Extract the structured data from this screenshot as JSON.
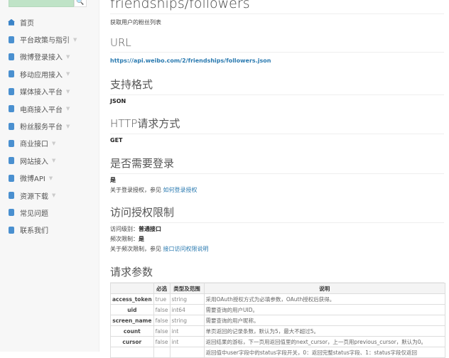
{
  "sidebar": {
    "items": [
      {
        "label": "首页",
        "chev": false
      },
      {
        "label": "平台政策与指引",
        "chev": true
      },
      {
        "label": "微博登录接入",
        "chev": true
      },
      {
        "label": "移动应用接入",
        "chev": true
      },
      {
        "label": "媒体接入平台",
        "chev": true
      },
      {
        "label": "电商接入平台",
        "chev": true
      },
      {
        "label": "粉丝服务平台",
        "chev": true
      },
      {
        "label": "商业接口",
        "chev": true
      },
      {
        "label": "网站接入",
        "chev": true
      },
      {
        "label": "微博API",
        "chev": true
      },
      {
        "label": "资源下载",
        "chev": true
      },
      {
        "label": "常见问题",
        "chev": false
      },
      {
        "label": "联系我们",
        "chev": false
      }
    ]
  },
  "main": {
    "title": "friendships/followers",
    "desc": "获取用户的粉丝列表",
    "url_heading": "URL",
    "url": "https://api.weibo.com/2/friendships/followers.json",
    "format_heading": "支持格式",
    "format": "JSON",
    "method_heading": "HTTP请求方式",
    "method": "GET",
    "login_heading": "是否需要登录",
    "login": "是",
    "login_note": "关于登录授权，参见 ",
    "login_link": "如何登录授权",
    "limit_heading": "访问授权限制",
    "level_label": "访问级别：",
    "level": "普通接口",
    "rate_label": "频次限制：",
    "rate": "是",
    "rate_note": "关于频次限制，参见 ",
    "rate_link": "接口访问权限说明",
    "params_heading": "请求参数",
    "table": {
      "headers": [
        "",
        "必选",
        "类型及范围",
        "说明"
      ],
      "rows": [
        [
          "access_token",
          "true",
          "string",
          "采用OAuth授权方式为必填参数，OAuth授权后获得。"
        ],
        [
          "uid",
          "false",
          "int64",
          "需要查询的用户UID。"
        ],
        [
          "screen_name",
          "false",
          "string",
          "需要查询的用户昵称。"
        ],
        [
          "count",
          "false",
          "int",
          "单页返回的记录条数，默认为5，最大不超过5。"
        ],
        [
          "cursor",
          "false",
          "int",
          "返回结果的游标，下一页用返回值里的next_cursor，上一页用previous_cursor，默认为0。"
        ],
        [
          "",
          "",
          "",
          "返回值中user字段中的status字段开关，0：返回完整status字段、1：status字段仅返回"
        ]
      ]
    }
  }
}
